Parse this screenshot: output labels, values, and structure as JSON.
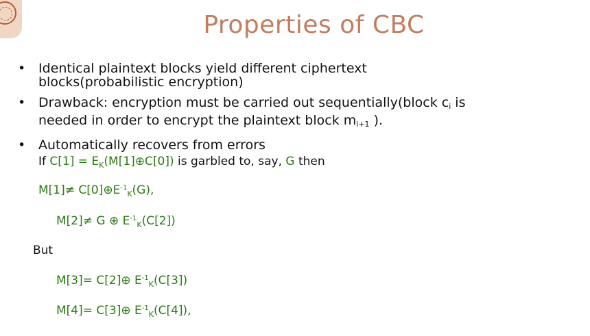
{
  "title": "Properties of CBC",
  "bullets": [
    {
      "line1": "Identical plaintext blocks yield different ciphertext",
      "line2": "blocks(probabilistic encryption)"
    },
    {
      "line1_a": "Drawback: encryption must be carried out sequentially(block c",
      "line1_sub": "i",
      "line1_b": " is",
      "line2_a": "needed in order to encrypt the plaintext block m",
      "line2_sub": "i+1",
      "line2_b": " )."
    },
    {
      "line1": "Automatically recovers from errors"
    }
  ],
  "garbled": {
    "if": "If ",
    "c1": "C[1] = ",
    "e": "E",
    "k": "K",
    "expr": "(M[1]⊕C[0])",
    "mid": " is garbled to, say, ",
    "g": "G",
    "end": " then"
  },
  "eq1": {
    "a": "M[1]≠ C[0]⊕E",
    "sup": "-1",
    "sub": "K",
    "b": "(G),"
  },
  "eq2": {
    "a": "M[2]≠ G ⊕ E",
    "sup": "-1",
    "sub": "K",
    "b": "(C[2])"
  },
  "but": "But",
  "eq3": {
    "a": "M[3]= C[2]⊕ E",
    "sup": "-1",
    "sub": "K",
    "b": "(C[3])"
  },
  "eq4": {
    "a": "M[4]= C[3]⊕ E",
    "sup": "-1",
    "sub": "K",
    "b": "(C[4]),"
  },
  "colors": {
    "title": "#c07e62",
    "math_green": "#2a7a12",
    "logo_bg": "#f1d7c3"
  }
}
